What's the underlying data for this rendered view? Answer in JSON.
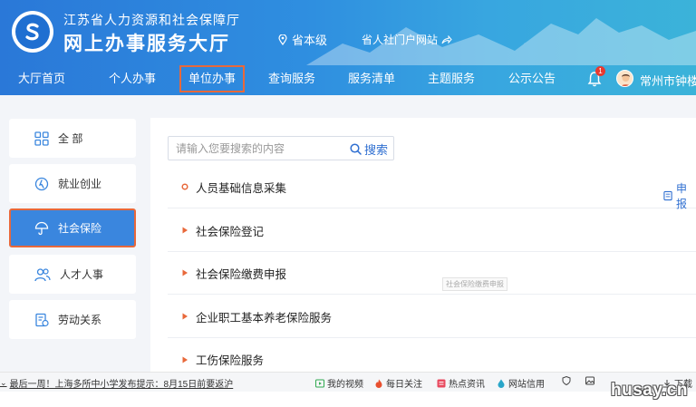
{
  "header": {
    "org_name": "江苏省人力资源和社会保障厅",
    "site_title": "网上办事服务大厅",
    "location": "省本级",
    "portal_link": "省人社门户网站",
    "notification_count": "1",
    "user_name": "常州市钟楼"
  },
  "nav": {
    "items": [
      "大厅首页",
      "个人办事",
      "单位办事",
      "查询服务",
      "服务清单",
      "主题服务",
      "公示公告"
    ],
    "active": "单位办事"
  },
  "sidebar": {
    "items": [
      {
        "label": "全 部",
        "icon": "grid-icon"
      },
      {
        "label": "就业创业",
        "icon": "employment-icon"
      },
      {
        "label": "社会保险",
        "icon": "umbrella-icon"
      },
      {
        "label": "人才人事",
        "icon": "people-icon"
      },
      {
        "label": "劳动关系",
        "icon": "document-icon"
      }
    ],
    "active": "社会保险"
  },
  "search": {
    "placeholder": "请输入您要搜索的内容",
    "button_label": "搜索"
  },
  "services": {
    "items": [
      "人员基础信息采集",
      "社会保险登记",
      "社会保险缴费申报",
      "企业职工基本养老保险服务",
      "工伤保险服务"
    ],
    "apply_label": "申报",
    "tooltip": "社会保险缴费申报"
  },
  "bottombar": {
    "news": "最后一周！上海多所中小学发布提示：8月15日前要返沪",
    "items": [
      "我的视频",
      "每日关注",
      "热点资讯",
      "网站信用",
      "下载"
    ]
  },
  "watermark": "husay.cn",
  "colors": {
    "header_blue": "#2f8fe0",
    "highlight_border": "#e8683a",
    "active_sidebar": "#3a86de",
    "link_blue": "#2f6fd1"
  }
}
